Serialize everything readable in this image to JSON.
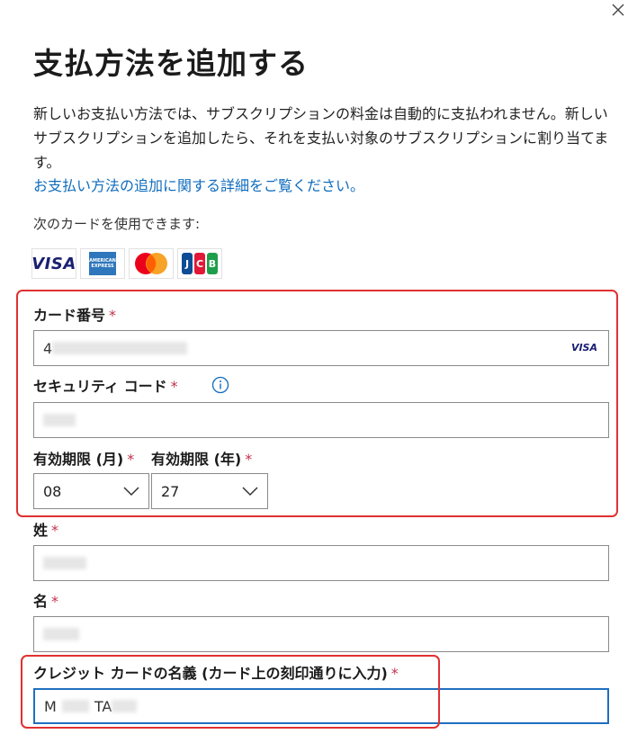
{
  "dialog": {
    "close_label": "×",
    "title": "支払方法を追加する",
    "description": "新しいお支払い方法では、サブスクリプションの料金は自動的に支払われません。新しいサブスクリプションを追加したら、それを支払い対象のサブスクリプションに割り当てます。",
    "learn_more_link": "お支払い方法の追加に関する詳細をご覧ください。"
  },
  "accepted_cards": {
    "label": "次のカードを使用できます:",
    "logos": [
      {
        "name": "visa",
        "text": "VISA"
      },
      {
        "name": "american-express",
        "text": "AMERICAN EXPRESS"
      },
      {
        "name": "mastercard",
        "text": ""
      },
      {
        "name": "jcb",
        "text": "JCB"
      }
    ]
  },
  "form": {
    "required_marker": "*",
    "card_number": {
      "label": "カード番号",
      "value_prefix": "4",
      "brand_badge": "VISA"
    },
    "security_code": {
      "label": "セキュリティ コード",
      "info_icon": "i"
    },
    "expiry_month": {
      "label": "有効期限 (月)",
      "value": "08"
    },
    "expiry_year": {
      "label": "有効期限 (年)",
      "value": "27"
    },
    "last_name": {
      "label": "姓"
    },
    "first_name": {
      "label": "名"
    },
    "cardholder_name": {
      "label": "クレジット カードの名義 (カード上の刻印通りに入力)",
      "value_start": "M",
      "value_mid": "TA"
    }
  },
  "colors": {
    "accent": "#0f6cbd",
    "required": "#c4314b",
    "highlight": "#e03131",
    "focus": "#1f6fbf"
  }
}
